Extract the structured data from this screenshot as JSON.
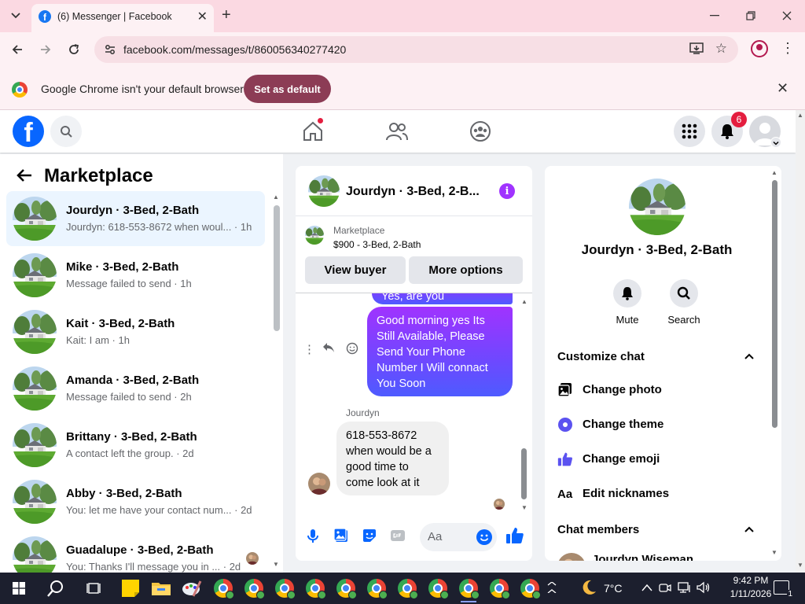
{
  "browser": {
    "tab_title": "(6) Messenger | Facebook",
    "url": "facebook.com/messages/t/860056340277420",
    "infobar_text": "Google Chrome isn't your default browser",
    "set_default_label": "Set as default"
  },
  "fb_header": {
    "notification_count": "6",
    "accent": "#0866ff"
  },
  "left_panel": {
    "title": "Marketplace",
    "conversations": [
      {
        "name": "Jourdyn · 3-Bed, 2-Bath",
        "snippet": "Jourdyn: 618-553-8672 when woul... · 1h",
        "active": true
      },
      {
        "name": "Mike · 3-Bed, 2-Bath",
        "snippet": "Message failed to send · 1h"
      },
      {
        "name": "Kait · 3-Bed, 2-Bath",
        "snippet": "Kait: I am · 1h"
      },
      {
        "name": "Amanda · 3-Bed, 2-Bath",
        "snippet": "Message failed to send · 2h"
      },
      {
        "name": "Brittany · 3-Bed, 2-Bath",
        "snippet": "A contact left the group. · 2d"
      },
      {
        "name": "Abby · 3-Bed, 2-Bath",
        "snippet": "You: let me have your contact num... · 2d"
      },
      {
        "name": "Guadalupe · 3-Bed, 2-Bath",
        "snippet": "You: Thanks I'll message you in ... · 2d"
      }
    ]
  },
  "chat": {
    "header_name": "Jourdyn · 3-Bed, 2-B...",
    "listing_label": "Marketplace",
    "listing_price": "$900 - 3-Bed, 2-Bath",
    "view_buyer_label": "View buyer",
    "more_options_label": "More options",
    "partial_message": "Yes, are you interested?",
    "outgoing_message": "Good morning yes Its Still Available, Please Send Your Phone Number I Will connact You Soon",
    "sender": "Jourdyn",
    "incoming_message": "618-553-8672 when would be a good time to come look at it",
    "composer_placeholder": "Aa"
  },
  "info_panel": {
    "name": "Jourdyn · 3-Bed, 2-Bath",
    "mute_label": "Mute",
    "search_label": "Search",
    "customize_heading": "Customize chat",
    "change_photo": "Change photo",
    "change_theme": "Change theme",
    "change_emoji": "Change emoji",
    "edit_nicknames": "Edit nicknames",
    "members_heading": "Chat members",
    "member_name": "Jourdyn Wiseman"
  },
  "taskbar": {
    "weather": "7°C",
    "time": "9:42 PM",
    "date": "1/11/2026",
    "notification_count": "1"
  },
  "colors": {
    "messenger_purple": "#a033ff",
    "like_blue": "#0866ff",
    "infobar_button": "#8c3c55"
  }
}
